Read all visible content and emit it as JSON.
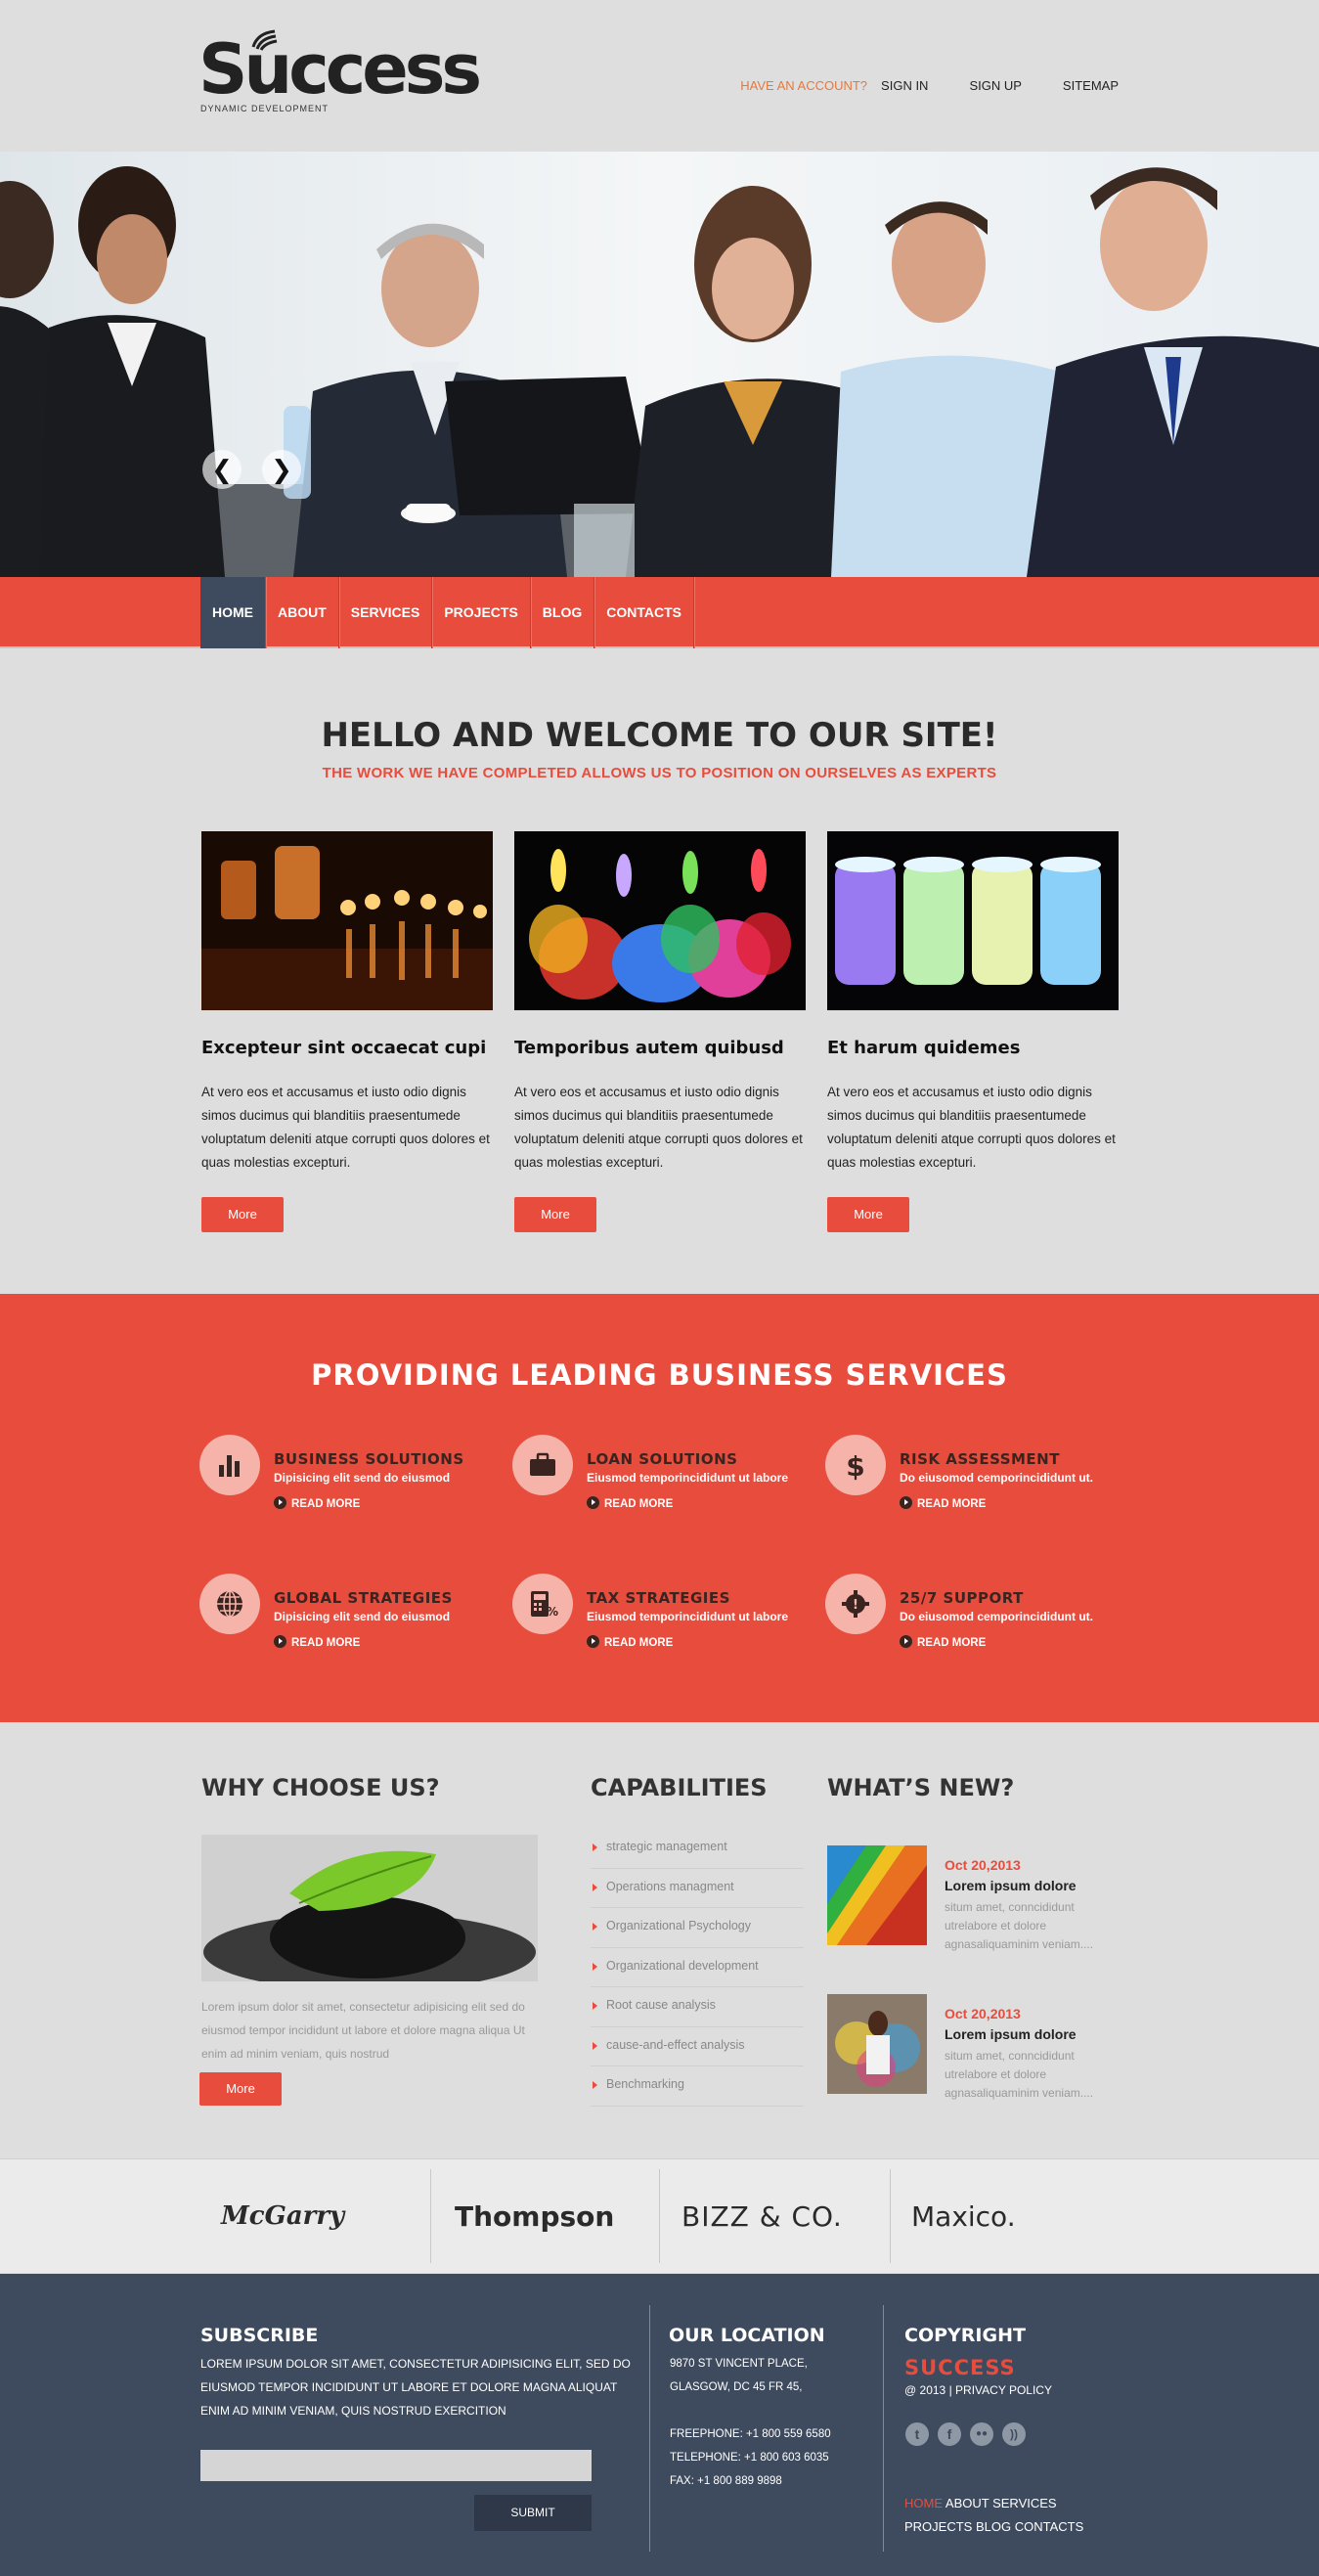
{
  "brand": {
    "name": "Success",
    "tagline": "DYNAMIC DEVELOPMENT"
  },
  "topnav": {
    "account": "HAVE AN ACCOUNT?",
    "signin": "SIGN IN",
    "signup": "SIGN UP",
    "sitemap": "SITEMAP"
  },
  "slider": {
    "prev": "❮",
    "next": "❯"
  },
  "mainnav": [
    "HOME",
    "ABOUT",
    "SERVICES",
    "PROJECTS",
    "BLOG",
    "CONTACTS"
  ],
  "welcome": {
    "title": "HELLO AND WELCOME TO OUR SITE!",
    "subtitle": "THE WORK WE HAVE COMPLETED ALLOWS US TO POSITION ON OURSELVES AS EXPERTS",
    "features": [
      {
        "title": "Excepteur sint occaecat cupi",
        "text": "At vero eos et accusamus et iusto odio dignis simos ducimus qui blanditiis praesentumede voluptatum deleniti atque corrupti quos dolores et quas molestias excepturi.",
        "button": "More"
      },
      {
        "title": "Temporibus autem quibusd",
        "text": "At vero eos et accusamus et iusto odio dignis simos ducimus qui blanditiis praesentumede voluptatum deleniti atque corrupti quos dolores et quas molestias excepturi.",
        "button": "More"
      },
      {
        "title": "Et harum quidemes",
        "text": "At vero eos et accusamus et iusto odio dignis simos ducimus qui blanditiis praesentumede voluptatum deleniti atque corrupti quos dolores et quas molestias excepturi.",
        "button": "More"
      }
    ]
  },
  "services": {
    "title": "PROVIDING LEADING BUSINESS SERVICES",
    "items": [
      {
        "title": "BUSINESS SOLUTIONS",
        "desc": "Dipisicing elit send do eiusmod",
        "more": "READ MORE",
        "icon": "bar-chart-icon"
      },
      {
        "title": "LOAN SOLUTIONS",
        "desc": "Eiusmod temporincididunt ut labore",
        "more": "READ MORE",
        "icon": "briefcase-icon"
      },
      {
        "title": "RISK ASSESSMENT",
        "desc": "Do eiusomod cemporincididunt ut.",
        "more": "READ MORE",
        "icon": "dollar-icon"
      },
      {
        "title": "GLOBAL STRATEGIES",
        "desc": "Dipisicing elit send do eiusmod",
        "more": "READ MORE",
        "icon": "globe-icon"
      },
      {
        "title": "TAX STRATEGIES",
        "desc": "Eiusmod temporincididunt ut labore",
        "more": "READ MORE",
        "icon": "calculator-icon"
      },
      {
        "title": "25/7 SUPPORT",
        "desc": "Do eiusomod cemporincididunt ut.",
        "more": "READ MORE",
        "icon": "support-gear-icon"
      }
    ]
  },
  "why": {
    "title": "WHY CHOOSE US?",
    "text": "Lorem ipsum dolor sit amet, consectetur adipisicing elit sed do eiusmod tempor incididunt ut labore et dolore magna aliqua Ut enim ad minim veniam, quis nostrud",
    "button": "More"
  },
  "capabilities": {
    "title": "CAPABILITIES",
    "items": [
      "strategic management",
      "Operations managment",
      "Organizational Psychology",
      "Organizational development",
      "Root cause analysis",
      "cause-and-effect analysis",
      "Benchmarking"
    ]
  },
  "whatsnew": {
    "title": "WHAT’S NEW?",
    "items": [
      {
        "date": "Oct 20,2013",
        "title": "Lorem ipsum dolore",
        "text": "situm amet, conncididunt utrelabore et dolore agnasaliquaminim veniam...."
      },
      {
        "date": "Oct 20,2013",
        "title": "Lorem ipsum dolore",
        "text": "situm amet, conncididunt utrelabore et dolore agnasaliquaminim veniam...."
      }
    ]
  },
  "clients": [
    "McGarry",
    "Thompson",
    "BIZZ & CO.",
    "Maxico."
  ],
  "footer": {
    "subscribe": {
      "title": "SUBSCRIBE",
      "text": "LOREM IPSUM DOLOR SIT AMET, CONSECTETUR ADIPISICING ELIT, SED DO EIUSMOD TEMPOR INCIDIDUNT UT LABORE ET DOLORE MAGNA ALIQUAT ENIM AD MINIM VENIAM, QUIS NOSTRUD EXERCITION",
      "placeholder": "",
      "button": "SUBMIT"
    },
    "location": {
      "title": "OUR LOCATION",
      "address1": "9870 ST VINCENT PLACE,",
      "address2": "GLASGOW, DC 45 FR 45,",
      "freephone": "FREEPHONE: +1 800 559 6580",
      "telephone": "TELEPHONE: +1 800 603 6035",
      "fax": "FAX: +1 800 889 9898"
    },
    "copyright": {
      "title": "COPYRIGHT",
      "brand": "SUCCESS",
      "year": "@ 2013",
      "sep": "|",
      "privacy": "PRIVACY POLICY",
      "social": [
        "twitter-icon",
        "facebook-icon",
        "flickr-icon",
        "rss-icon"
      ],
      "links": [
        "HOME",
        "ABOUT",
        "SERVICES",
        "PROJECTS",
        "BLOG",
        "CONTACTS"
      ]
    }
  },
  "colors": {
    "accent": "#e84c3d",
    "dark": "#3e4b5e",
    "orange": "#e8783a",
    "background": "#dedede"
  }
}
